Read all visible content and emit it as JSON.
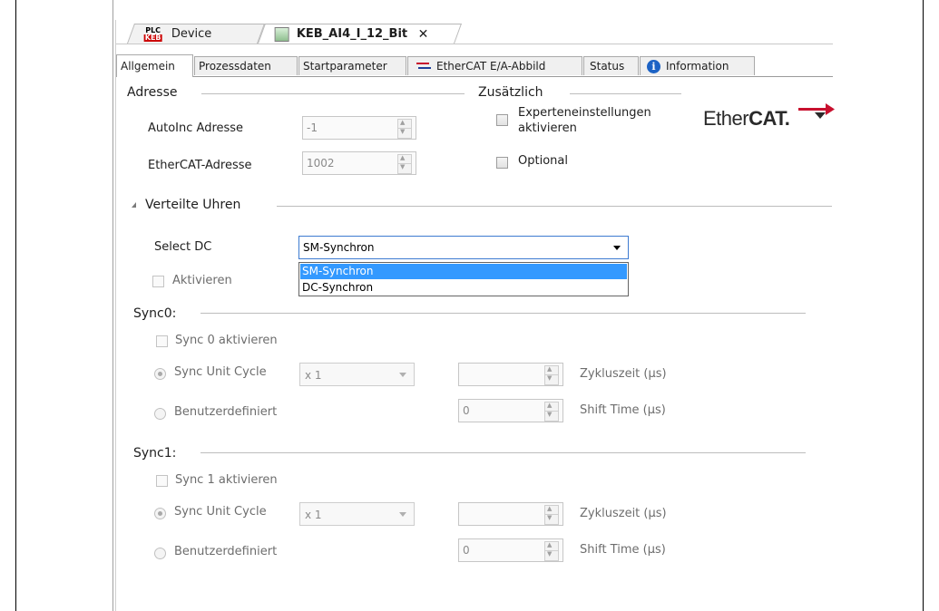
{
  "doc_tabs": [
    {
      "label": "Device",
      "icon": "plc-keb-icon",
      "icon_top": "PLC",
      "icon_bottom": "KEB"
    },
    {
      "label": "KEB_AI4_I_12_Bit",
      "icon": "module-icon",
      "close": "✕"
    }
  ],
  "prop_tabs": [
    "Allgemein",
    "Prozessdaten",
    "Startparameter",
    "EtherCAT E/A-Abbild",
    "Status",
    "Information"
  ],
  "adresse": {
    "heading": "Adresse",
    "autoinc_label": "AutoInc Adresse",
    "autoinc_value": "-1",
    "ethercat_label": "EtherCAT-Adresse",
    "ethercat_value": "1002"
  },
  "zusaetzlich": {
    "heading": "Zusätzlich",
    "experten_label_1": "Experteneinstellungen",
    "experten_label_2": "aktivieren",
    "optional_label": "Optional"
  },
  "logo": {
    "text_light": "Ether",
    "text_bold": "CAT."
  },
  "verteilte_uhren": {
    "heading": "Verteilte Uhren",
    "select_dc_label": "Select DC",
    "select_dc_value": "SM-Synchron",
    "dropdown_options": [
      "SM-Synchron",
      "DC-Synchron"
    ],
    "aktivieren_label": "Aktivieren"
  },
  "sync0": {
    "heading": "Sync0:",
    "aktivieren_label": "Sync 0 aktivieren",
    "unit_cycle_label": "Sync Unit Cycle",
    "unit_cycle_value": "x 1",
    "zykluszeit_label": "Zykluszeit (µs)",
    "benutzer_label": "Benutzerdefiniert",
    "shift_value": "0",
    "shift_label": "Shift Time (µs)"
  },
  "sync1": {
    "heading": "Sync1:",
    "aktivieren_label": "Sync 1 aktivieren",
    "unit_cycle_label": "Sync Unit Cycle",
    "unit_cycle_value": "x 1",
    "zykluszeit_label": "Zykluszeit (µs)",
    "benutzer_label": "Benutzerdefiniert",
    "shift_value": "0",
    "shift_label": "Shift Time (µs)"
  }
}
